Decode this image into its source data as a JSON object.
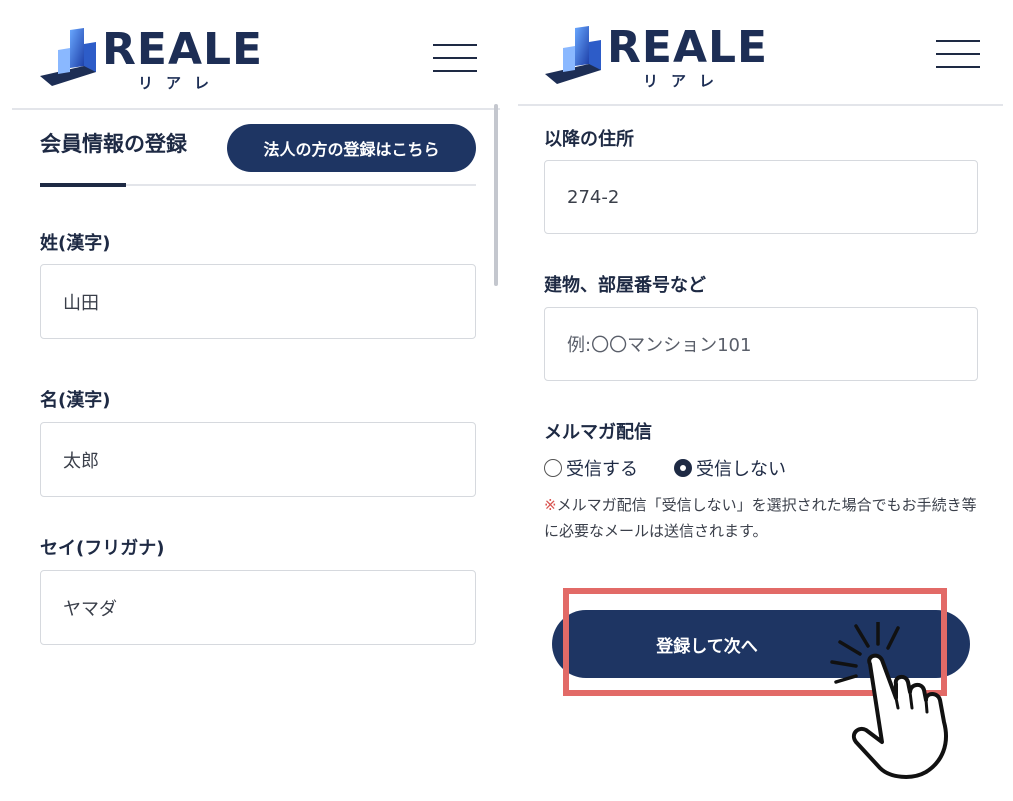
{
  "brand": {
    "name": "REALE",
    "kana": "リアレ",
    "colors": {
      "navy": "#1e3563",
      "text": "#1e2a44",
      "highlight": "#e26a67",
      "note_mark": "#d9534f"
    }
  },
  "left_screen": {
    "section_title": "会員情報の登録",
    "corporate_button": "法人の方の登録はこちら",
    "fields": [
      {
        "label": "姓(漢字)",
        "value": "山田"
      },
      {
        "label": "名(漢字)",
        "value": "太郎"
      },
      {
        "label": "セイ(フリガナ)",
        "value": "ヤマダ"
      }
    ]
  },
  "right_screen": {
    "fields": [
      {
        "label": "以降の住所",
        "value": "274-2"
      },
      {
        "label": "建物、部屋番号など",
        "placeholder": "例:〇〇マンション101"
      }
    ],
    "newsletter": {
      "label": "メルマガ配信",
      "options": [
        {
          "label": "受信する",
          "checked": false
        },
        {
          "label": "受信しない",
          "checked": true
        }
      ],
      "note_mark": "※",
      "note": "メルマガ配信「受信しない」を選択された場合でもお手続き等に必要なメールは送信されます。"
    },
    "submit_button": "登録して次へ"
  },
  "icons": [
    "logo-mark-icon",
    "hamburger-menu-icon",
    "radio-icon",
    "pointing-hand-icon"
  ]
}
